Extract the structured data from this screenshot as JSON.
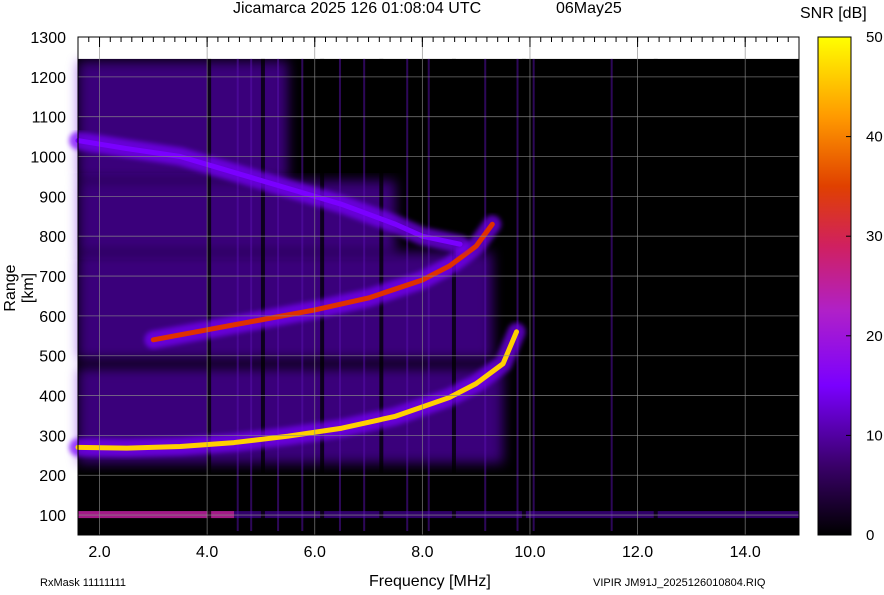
{
  "header": {
    "title": "Jicamarca 2025 126 01:08:04 UTC",
    "date": "06May25"
  },
  "colorbar": {
    "title": "SNR [dB]",
    "ticks": [
      "50",
      "40",
      "30",
      "20",
      "10",
      "0"
    ],
    "range": [
      0,
      50
    ]
  },
  "footer": {
    "rxmask": "RxMask 11111111",
    "file": "VIPIR  JM91J_2025126010804.RIQ"
  },
  "chart_data": {
    "type": "heatmap",
    "title": "Jicamarca 2025 126 01:08:04 UTC",
    "xlabel": "Frequency [MHz]",
    "ylabel": "Range [km]",
    "xlim": [
      1.6,
      15.0
    ],
    "ylim": [
      50,
      1300
    ],
    "x_ticks": [
      "2.0",
      "4.0",
      "6.0",
      "8.0",
      "10.0",
      "12.0",
      "14.0"
    ],
    "y_ticks": [
      "100",
      "200",
      "300",
      "400",
      "500",
      "600",
      "700",
      "800",
      "900",
      "1000",
      "1100",
      "1200",
      "1300"
    ],
    "colorscale": [
      "#000000",
      "#3a006a",
      "#7a00ff",
      "#c020a0",
      "#e03000",
      "#ff8c00",
      "#ffd000",
      "#ffff00"
    ],
    "data_top_range": 1245,
    "traces": [
      {
        "name": "",
        "freq": [
          1.6,
          2.5,
          3.5,
          4.5,
          5.5,
          6.5,
          7.5,
          8.5,
          9.0,
          9.5,
          9.75
        ],
        "range": [
          270,
          268,
          272,
          282,
          298,
          318,
          348,
          395,
          430,
          480,
          560
        ],
        "snr": 40
      },
      {
        "name": "",
        "freq": [
          3.0,
          4.0,
          5.0,
          6.0,
          7.0,
          8.0,
          8.5,
          9.0,
          9.3
        ],
        "range": [
          540,
          565,
          590,
          615,
          645,
          690,
          725,
          775,
          830
        ],
        "snr": 25
      },
      {
        "name": "",
        "freq": [
          1.6,
          2.5,
          3.5,
          4.5,
          5.5,
          6.5,
          7.5,
          8.0,
          8.7
        ],
        "range": [
          1040,
          1020,
          1000,
          960,
          920,
          880,
          830,
          800,
          780
        ],
        "snr": 15
      }
    ],
    "diffuse_bands": [
      {
        "freq": [
          1.6,
          9.5
        ],
        "range": [
          230,
          470
        ],
        "snr": 12
      },
      {
        "freq": [
          1.6,
          9.3
        ],
        "range": [
          490,
          760
        ],
        "snr": 12
      },
      {
        "freq": [
          1.6,
          7.5
        ],
        "range": [
          760,
          940
        ],
        "snr": 10
      },
      {
        "freq": [
          1.6,
          5.5
        ],
        "range": [
          940,
          1240
        ],
        "snr": 8
      }
    ],
    "e_layer": {
      "freq": [
        1.6,
        15.0
      ],
      "range": 100,
      "snr": 18
    }
  }
}
